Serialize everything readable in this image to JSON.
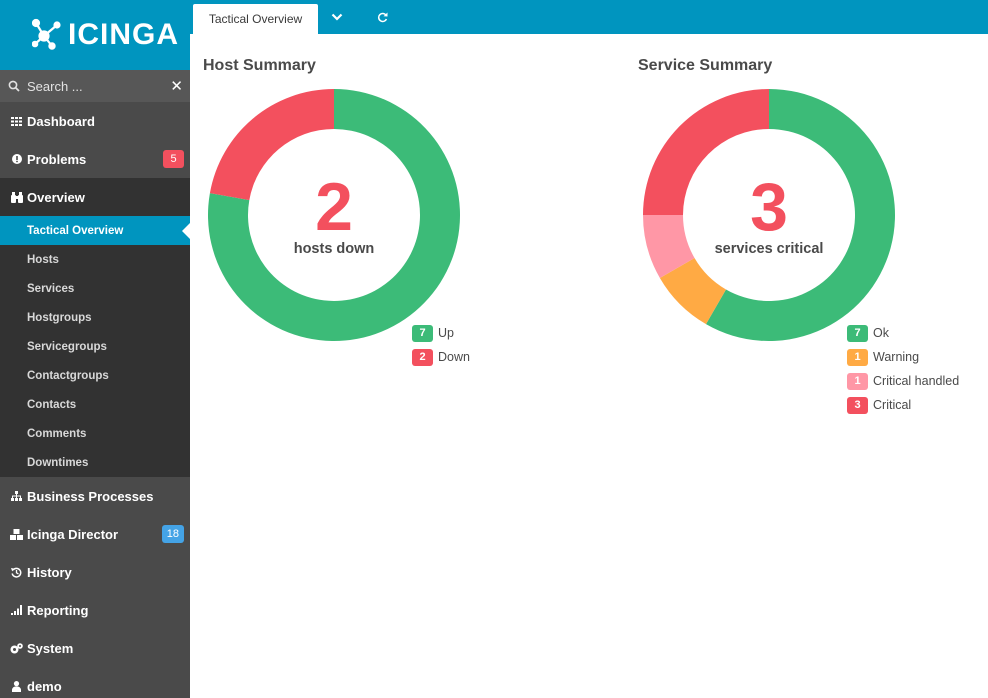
{
  "app": {
    "logo_text": "ICINGA"
  },
  "search": {
    "placeholder": "Search ..."
  },
  "nav": {
    "dashboard": "Dashboard",
    "problems": {
      "label": "Problems",
      "badge": "5"
    },
    "overview": "Overview",
    "overview_items": [
      "Tactical Overview",
      "Hosts",
      "Services",
      "Hostgroups",
      "Servicegroups",
      "Contactgroups",
      "Contacts",
      "Comments",
      "Downtimes"
    ],
    "business_processes": "Business Processes",
    "icinga_director": {
      "label": "Icinga Director",
      "badge": "18"
    },
    "history": "History",
    "reporting": "Reporting",
    "system": "System",
    "user": "demo"
  },
  "tabs": {
    "active": "Tactical Overview"
  },
  "colors": {
    "brand": "#0095bf",
    "ok": "#3cbb78",
    "warning": "#ffaa44",
    "critical_handled": "#ff97a6",
    "critical": "#f3505e"
  },
  "host_summary": {
    "title": "Host Summary",
    "big_number": "2",
    "caption": "hosts down",
    "legend": [
      {
        "count": "7",
        "label": "Up",
        "color": "#3cbb78"
      },
      {
        "count": "2",
        "label": "Down",
        "color": "#f3505e"
      }
    ]
  },
  "service_summary": {
    "title": "Service Summary",
    "big_number": "3",
    "caption": "services critical",
    "legend": [
      {
        "count": "7",
        "label": "Ok",
        "color": "#3cbb78"
      },
      {
        "count": "1",
        "label": "Warning",
        "color": "#ffaa44"
      },
      {
        "count": "1",
        "label": "Critical handled",
        "color": "#ff97a6"
      },
      {
        "count": "3",
        "label": "Critical",
        "color": "#f3505e"
      }
    ]
  }
}
